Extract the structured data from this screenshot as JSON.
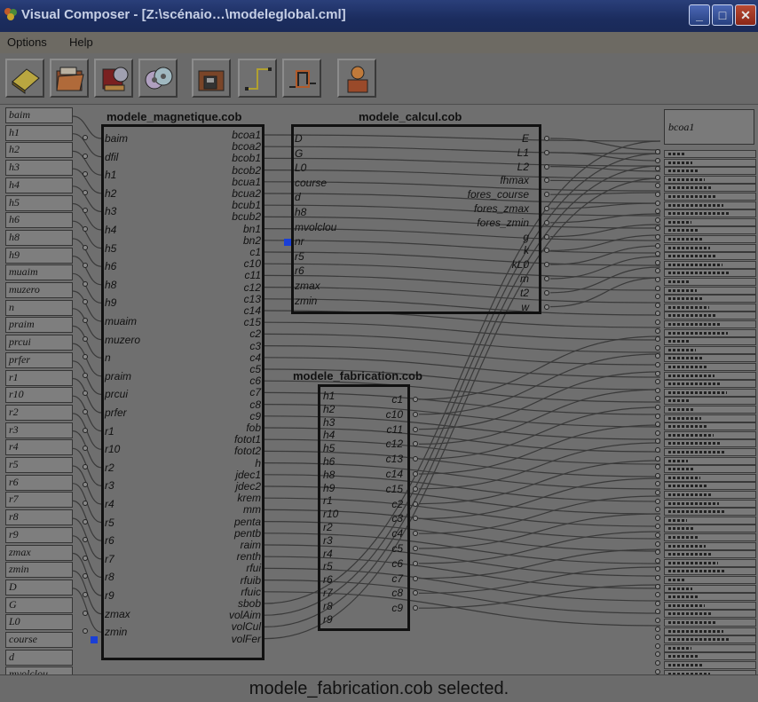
{
  "window": {
    "title": "Visual Composer - [Z:\\scénaio…\\modeleglobal.cml]",
    "minimize_icon": "minimize-icon",
    "maximize_icon": "maximize-icon",
    "close_icon": "close-icon"
  },
  "menu": [
    "Options",
    "Help"
  ],
  "toolbar": {
    "icons": [
      "eraser-icon",
      "open-folder-icon",
      "library-books-icon",
      "cd-disks-icon",
      "save-folder-icon",
      "connector-icon",
      "layout-icon",
      "run-icon"
    ]
  },
  "inputs": [
    "baim",
    "h1",
    "h2",
    "h3",
    "h4",
    "h5",
    "h6",
    "h8",
    "h9",
    "muaim",
    "muzero",
    "n",
    "praim",
    "prcui",
    "prfer",
    "r1",
    "r10",
    "r2",
    "r3",
    "r4",
    "r5",
    "r6",
    "r7",
    "r8",
    "r9",
    "zmax",
    "zmin",
    "D",
    "G",
    "L0",
    "course",
    "d",
    "mvolclou"
  ],
  "blocks": {
    "magnetique": {
      "title": "modele_magnetique.cob",
      "inputs": [
        "baim",
        "dfil",
        "h1",
        "h2",
        "h3",
        "h4",
        "h5",
        "h6",
        "h8",
        "h9",
        "muaim",
        "muzero",
        "n",
        "praim",
        "prcui",
        "prfer",
        "r1",
        "r10",
        "r2",
        "r3",
        "r4",
        "r5",
        "r6",
        "r7",
        "r8",
        "r9",
        "zmax",
        "zmin"
      ],
      "outputs": [
        "bcoa1",
        "bcoa2",
        "bcob1",
        "bcob2",
        "bcua1",
        "bcua2",
        "bcub1",
        "bcub2",
        "bn1",
        "bn2",
        "c1",
        "c10",
        "c11",
        "c12",
        "c13",
        "c14",
        "c15",
        "c2",
        "c3",
        "c4",
        "c5",
        "c6",
        "c7",
        "c8",
        "c9",
        "fob",
        "fotot1",
        "fotot2",
        "h",
        "jdec1",
        "jdec2",
        "krem",
        "mm",
        "penta",
        "pentb",
        "raim",
        "renth",
        "rfui",
        "rfuib",
        "rfuic",
        "sbob",
        "volAim",
        "volCul",
        "volFer"
      ]
    },
    "calcul": {
      "title": "modele_calcul.cob",
      "inputs": [
        "D",
        "G",
        "L0",
        "course",
        "d",
        "h8",
        "mvolclou",
        "nr",
        "r5",
        "r6",
        "zmax",
        "zmin"
      ],
      "outputs": [
        "E",
        "L1",
        "L2",
        "fhmax",
        "fores_course",
        "fores_zmax",
        "fores_zmin",
        "g",
        "k",
        "kL0",
        "m",
        "t2",
        "w"
      ]
    },
    "fabrication": {
      "title": "modele_fabrication.cob",
      "inputs": [
        "h1",
        "h2",
        "h3",
        "h4",
        "h5",
        "h6",
        "h8",
        "h9",
        "r1",
        "r10",
        "r2",
        "r3",
        "r4",
        "r5",
        "r6",
        "r7",
        "r8",
        "r9"
      ],
      "outputs": [
        "c1",
        "c10",
        "c11",
        "c12",
        "c13",
        "c14",
        "c15",
        "c2",
        "c3",
        "c4",
        "c5",
        "c6",
        "c7",
        "c8",
        "c9"
      ]
    }
  },
  "outputs_panel": {
    "first": "bcoa1"
  },
  "status": "modele_fabrication.cob selected.",
  "colors": {
    "titlebar": "#1b2c5e",
    "canvas": "#6f6f6f",
    "selected_port": "#1a3fd6"
  }
}
